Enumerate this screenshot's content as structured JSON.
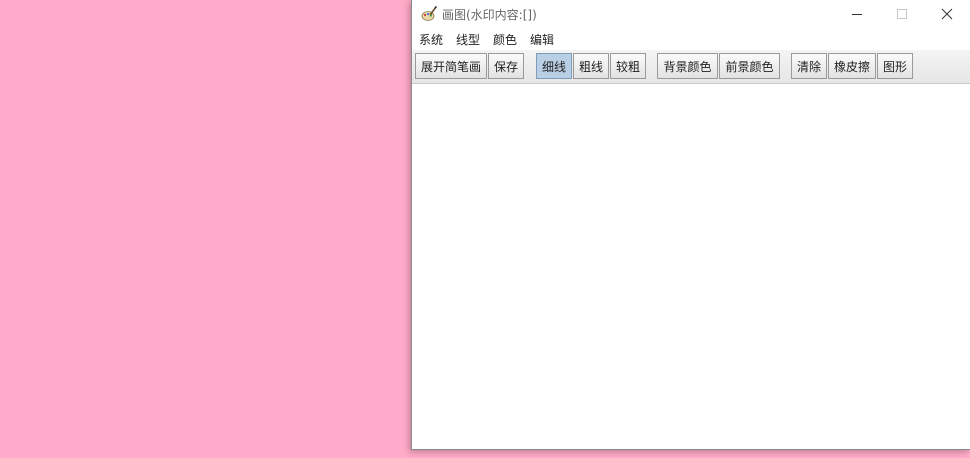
{
  "colors": {
    "desktop": "#ffaac8",
    "window_bg": "#ffffff",
    "active_button": "#b8cfe5"
  },
  "titlebar": {
    "icon": "paint-palette-icon",
    "title": "画图(水印内容:[])",
    "minimize_icon": "minimize-icon",
    "maximize_icon": "maximize-icon",
    "close_icon": "close-icon"
  },
  "menu": {
    "items": [
      {
        "label": "系统"
      },
      {
        "label": "线型"
      },
      {
        "label": "颜色"
      },
      {
        "label": "编辑"
      }
    ]
  },
  "toolbar": {
    "expand_label": "展开简笔画",
    "save_label": "保存",
    "thin_label": "细线",
    "thick_label": "粗线",
    "thicker_label": "较粗",
    "bg_color_label": "背景颜色",
    "fg_color_label": "前景颜色",
    "clear_label": "清除",
    "eraser_label": "橡皮擦",
    "shape_label": "图形",
    "active": "细线"
  }
}
